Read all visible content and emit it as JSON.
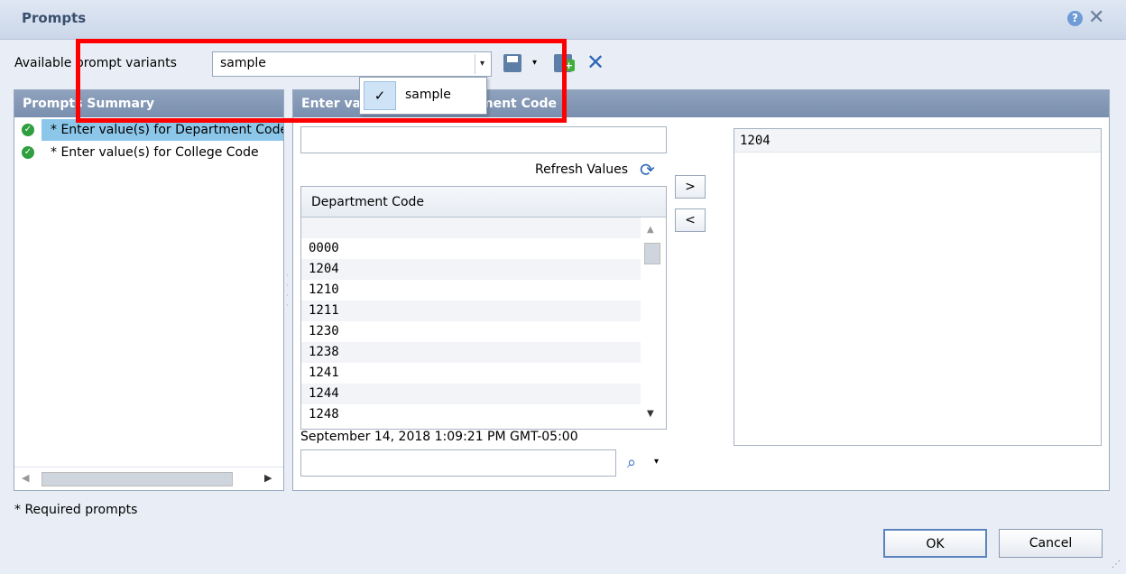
{
  "window": {
    "title": "Prompts",
    "help_glyph": "?",
    "close_glyph": "✕"
  },
  "toolbar": {
    "variants_label": "Available prompt variants",
    "variant_value": "sample",
    "dropdown_glyph": "▾"
  },
  "variant_popup": {
    "items": [
      {
        "label": "sample",
        "check": "✓"
      }
    ]
  },
  "summary": {
    "header": "Prompts Summary",
    "items": [
      {
        "label": "* Enter value(s) for Department Code"
      },
      {
        "label": "* Enter value(s) for College Code"
      }
    ]
  },
  "values_panel": {
    "header": "Enter value(s) for Department Code",
    "refresh_label": "Refresh Values",
    "list_header": "Department Code",
    "items": [
      "",
      "0000",
      "1204",
      "1210",
      "1211",
      "1230",
      "1238",
      "1241",
      "1244",
      "1248"
    ],
    "timestamp": "September 14, 2018 1:09:21 PM GMT-05:00",
    "add_label": ">",
    "remove_label": "<",
    "selected": [
      "1204"
    ]
  },
  "footer": {
    "required_note": "* Required prompts",
    "ok_label": "OK",
    "cancel_label": "Cancel"
  },
  "colors": {
    "accent": "#2d66b8",
    "highlight": "#ff0000",
    "header": "#8fa2bd",
    "selected_row": "#8cc7ea"
  }
}
